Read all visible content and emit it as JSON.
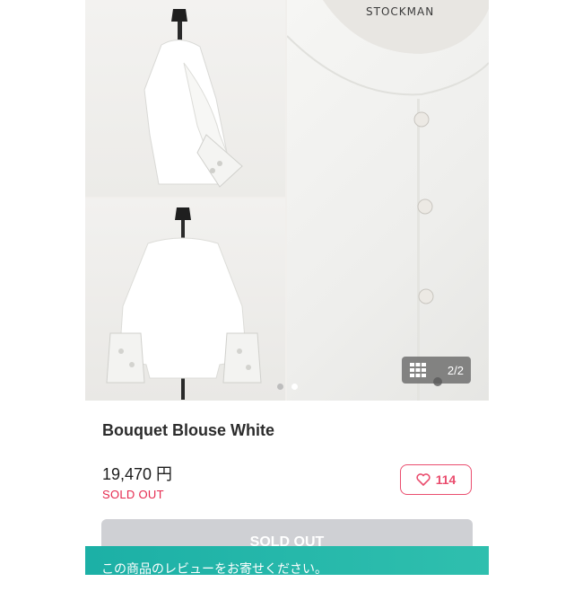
{
  "gallery": {
    "mannequin_label": "STOCKMAN",
    "page_counter": "2/2",
    "icons": {
      "grid": "grid-icon"
    },
    "dots_total": 2,
    "dots_active_index": 1
  },
  "product": {
    "title": "Bouquet Blouse White",
    "price": "19,470 円",
    "status": "SOLD OUT"
  },
  "like": {
    "icon": "heart-icon",
    "count": "114"
  },
  "sold_button": {
    "label": "SOLD OUT"
  },
  "review_banner": {
    "text": "この商品のレビューをお寄せください。"
  },
  "colors": {
    "accent": "#ea4d6e",
    "sold": "#e5284e",
    "banner": "#1cb0a6",
    "disabled": "#cfd0d4"
  }
}
